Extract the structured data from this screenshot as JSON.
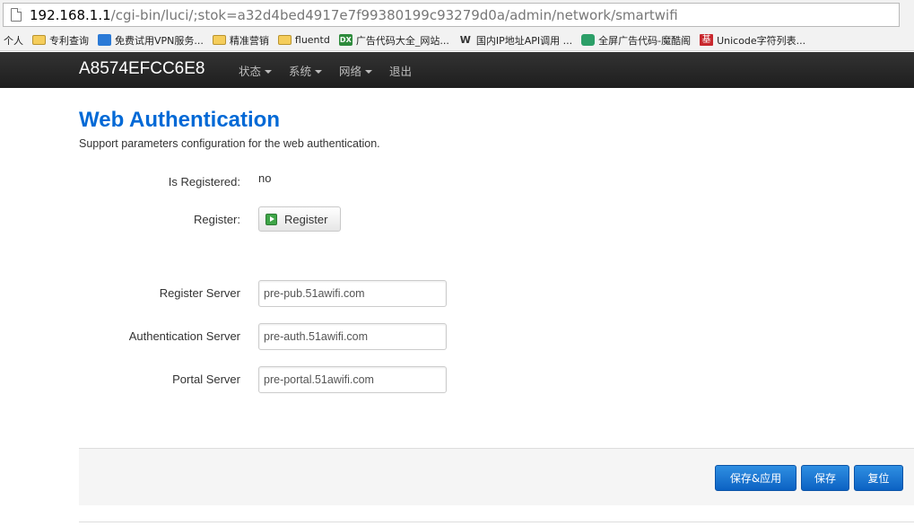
{
  "browser": {
    "url_host": "192.168.1.1",
    "url_path": "/cgi-bin/luci/;stok=a32d4bed4917e7f99380199c93279d0a/admin/network/smartwifi",
    "bookmarks": [
      {
        "label": "个人",
        "icon": "none"
      },
      {
        "label": "专利查询",
        "icon": "folder-icon"
      },
      {
        "label": "免费试用VPN服务...",
        "icon": "vpn-icon"
      },
      {
        "label": "精准营销",
        "icon": "folder-icon"
      },
      {
        "label": "fluentd",
        "icon": "folder-icon"
      },
      {
        "label": "广告代码大全_网站...",
        "icon": "dx-icon"
      },
      {
        "label": "国内IP地址API调用 ...",
        "icon": "w-icon"
      },
      {
        "label": "全屏广告代码-魔酷阁",
        "icon": "mk-icon"
      },
      {
        "label": "Unicode字符列表...",
        "icon": "ji-icon"
      }
    ]
  },
  "navbar": {
    "brand": "A8574EFCC6E8",
    "menu": [
      "状态",
      "系统",
      "网络",
      "退出"
    ]
  },
  "main": {
    "title": "Web Authentication",
    "description": "Support parameters configuration for the web authentication.",
    "is_registered_label": "Is Registered:",
    "is_registered_value": "no",
    "register_label": "Register:",
    "register_button": "Register",
    "register_server_label": "Register Server",
    "register_server_value": "pre-pub.51awifi.com",
    "auth_server_label": "Authentication Server",
    "auth_server_value": "pre-auth.51awifi.com",
    "portal_server_label": "Portal Server",
    "portal_server_value": "pre-portal.51awifi.com"
  },
  "actions": {
    "save_apply": "保存&应用",
    "save": "保存",
    "reset": "复位"
  },
  "colors": {
    "title": "#0069d6",
    "navbar": "#222222",
    "primary_button": "#0c62c3"
  }
}
